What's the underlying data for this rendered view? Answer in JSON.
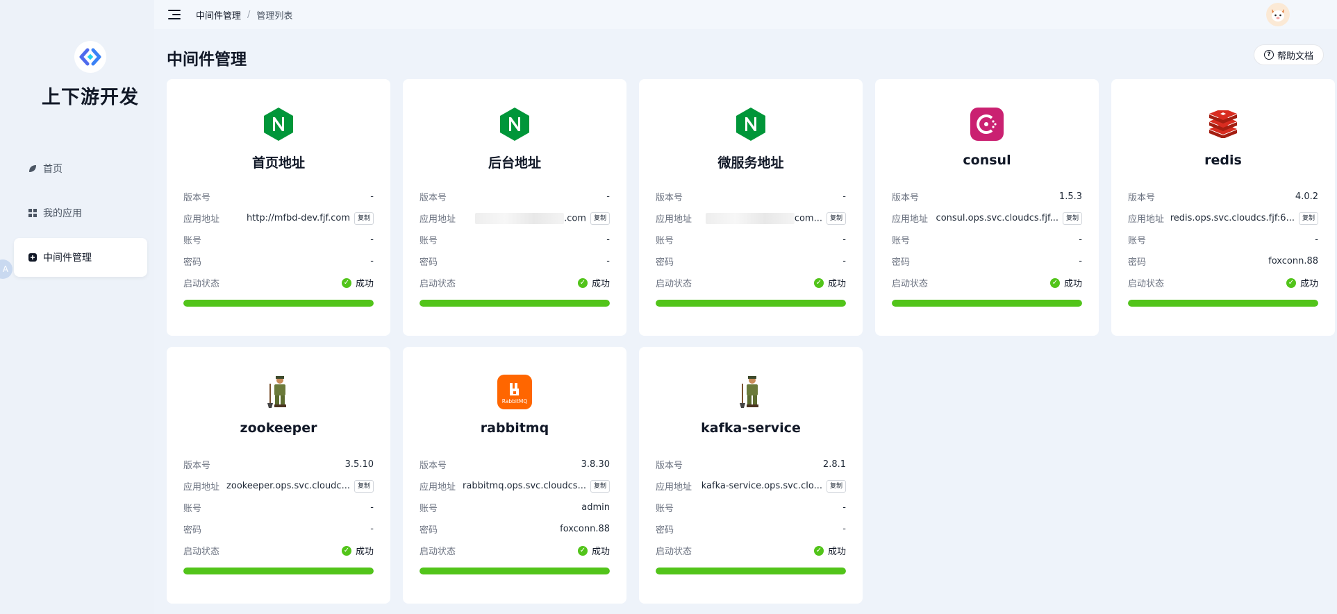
{
  "app": {
    "brand": "上下游开发"
  },
  "header": {
    "breadcrumb": [
      "中间件管理",
      "管理列表"
    ],
    "separator": "/"
  },
  "sidebar": {
    "items": [
      {
        "label": "首页",
        "icon": "leaf-icon",
        "active": false
      },
      {
        "label": "我的应用",
        "icon": "apps-grid-icon",
        "active": false
      },
      {
        "label": "中间件管理",
        "icon": "middleware-icon",
        "active": true
      }
    ],
    "collapse_label": "A"
  },
  "main": {
    "title": "中间件管理",
    "help_label": "帮助文档"
  },
  "labels": {
    "version": "版本号",
    "address": "应用地址",
    "account": "账号",
    "password": "密码",
    "status": "启动状态",
    "copy": "复制"
  },
  "cards": [
    {
      "name": "首页地址",
      "icon": "nginx-icon",
      "version": "-",
      "address": "http://mfbd-dev.fjf.com",
      "account": "-",
      "password": "-",
      "status": "成功",
      "progress": 1.0
    },
    {
      "name": "后台地址",
      "icon": "nginx-icon",
      "version": "-",
      "address": ".com",
      "account": "-",
      "password": "-",
      "status": "成功",
      "progress": 1.0
    },
    {
      "name": "微服务地址",
      "icon": "nginx-icon",
      "version": "-",
      "address": "com...",
      "account": "-",
      "password": "-",
      "status": "成功",
      "progress": 1.0
    },
    {
      "name": "consul",
      "icon": "consul-icon",
      "version": "1.5.3",
      "address": "consul.ops.svc.cloudcs.fjf...",
      "account": "-",
      "password": "-",
      "status": "成功",
      "progress": 1.0
    },
    {
      "name": "redis",
      "icon": "redis-icon",
      "version": "4.0.2",
      "address": "redis.ops.svc.cloudcs.fjf:6...",
      "account": "-",
      "password": "foxconn.88",
      "status": "成功",
      "progress": 1.0
    },
    {
      "name": "zookeeper",
      "icon": "zookeeper-icon",
      "version": "3.5.10",
      "address": "zookeeper.ops.svc.cloudc...",
      "account": "-",
      "password": "-",
      "status": "成功",
      "progress": 1.0
    },
    {
      "name": "rabbitmq",
      "icon": "rabbitmq-icon",
      "icon_text": "RabbitMQ",
      "version": "3.8.30",
      "address": "rabbitmq.ops.svc.cloudcs...",
      "account": "admin",
      "password": "foxconn.88",
      "status": "成功",
      "progress": 1.0
    },
    {
      "name": "kafka-service",
      "icon": "zookeeper-icon",
      "version": "2.8.1",
      "address": "kafka-service.ops.svc.clo...",
      "account": "-",
      "password": "-",
      "status": "成功",
      "progress": 1.0
    }
  ],
  "colors": {
    "success": "#52c41a",
    "nginx": "#009639",
    "consul": "#ca2171",
    "redis": "#d82c20",
    "rabbitmq": "#ff6600"
  }
}
